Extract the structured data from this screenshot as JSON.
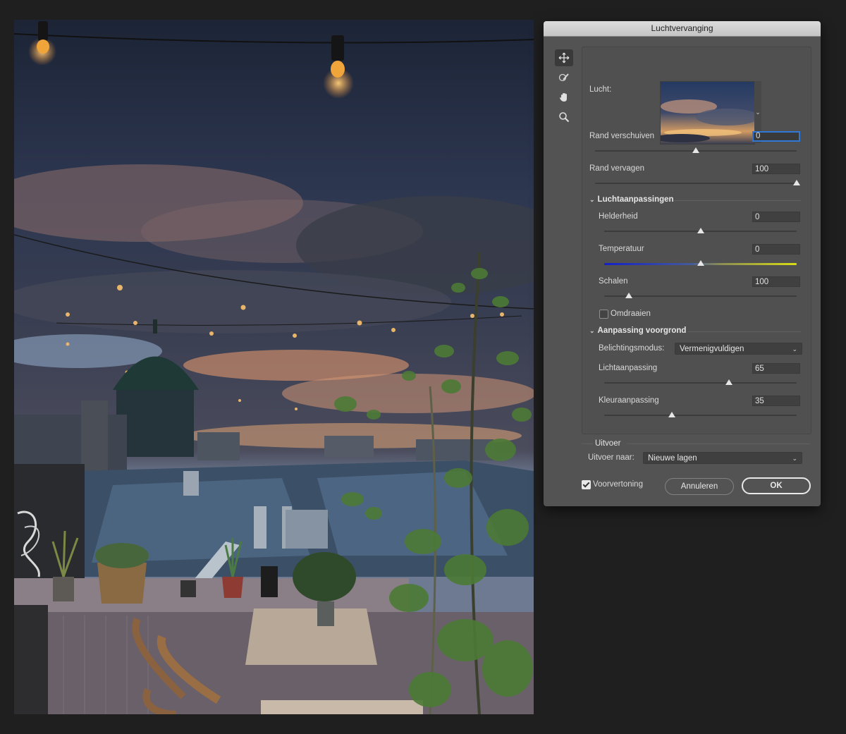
{
  "dialog": {
    "title": "Luchtvervanging",
    "tools": [
      "move-icon",
      "sky-brush-icon",
      "hand-icon",
      "zoom-icon"
    ],
    "sky_label": "Lucht:",
    "shift_edge": {
      "label": "Rand verschuiven",
      "value": "0",
      "slider": 0.5
    },
    "fade_edge": {
      "label": "Rand vervagen",
      "value": "100",
      "slider": 1.0
    },
    "sky_adjustments": {
      "title": "Luchtaanpassingen",
      "brightness": {
        "label": "Helderheid",
        "value": "0",
        "slider": 0.5
      },
      "temperature": {
        "label": "Temperatuur",
        "value": "0",
        "slider": 0.5
      },
      "scale": {
        "label": "Schalen",
        "value": "100",
        "slider": 0.13
      },
      "flip": {
        "label": "Omdraaien",
        "checked": false
      }
    },
    "foreground": {
      "title": "Aanpassing voorgrond",
      "lighting_mode_label": "Belichtingsmodus:",
      "lighting_mode_value": "Vermenigvuldigen",
      "lighting": {
        "label": "Lichtaanpassing",
        "value": "65",
        "slider": 0.65
      },
      "color": {
        "label": "Kleuraanpassing",
        "value": "35",
        "slider": 0.35
      }
    },
    "output": {
      "title": "Uitvoer",
      "output_to_label": "Uitvoer naar:",
      "output_to_value": "Nieuwe lagen"
    },
    "preview": {
      "label": "Voorvertoning",
      "checked": true
    },
    "cancel_label": "Annuleren",
    "ok_label": "OK"
  },
  "colors": {
    "dialog_bg": "#535353",
    "accent": "#2f78d6",
    "temp_cold": "#1420c8",
    "temp_warm": "#d9dc12"
  }
}
